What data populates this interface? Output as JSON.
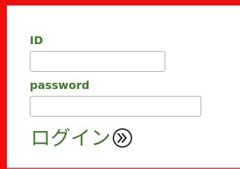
{
  "form": {
    "id_label": "ID",
    "id_value": "",
    "password_label": "password",
    "password_value": "",
    "login_label": "ログイン",
    "login_icon": "double-chevron-right-circle-icon"
  },
  "colors": {
    "border": "#ee1111",
    "label": "#3d7a2a"
  }
}
